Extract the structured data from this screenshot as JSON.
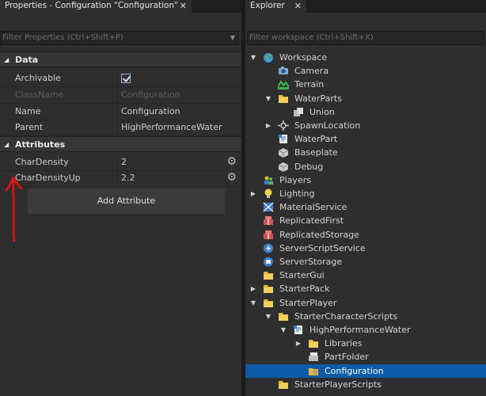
{
  "properties_panel": {
    "tab_title": "Properties - Configuration \"Configuration\"",
    "close_glyph": "✕",
    "filter_placeholder": "Filter Properties (Ctrl+Shift+P)",
    "sections": {
      "data": {
        "title": "Data"
      },
      "attributes": {
        "title": "Attributes"
      }
    },
    "rows": [
      {
        "name": "Archivable",
        "value": "",
        "type": "checkbox",
        "checked": true
      },
      {
        "name": "ClassName",
        "value": "Configuration",
        "type": "readonly"
      },
      {
        "name": "Name",
        "value": "Configuration",
        "type": "text"
      },
      {
        "name": "Parent",
        "value": "HighPerformanceWater",
        "type": "text"
      }
    ],
    "attributes": [
      {
        "name": "CharDensity",
        "value": "2"
      },
      {
        "name": "CharDensityUp",
        "value": "2.2"
      }
    ],
    "add_attribute_label": "Add Attribute",
    "annotation_color": "#d01515"
  },
  "explorer_panel": {
    "tab_title": "Explorer",
    "close_glyph": "✕",
    "filter_placeholder": "Filter workspace (Ctrl+Shift+X)",
    "selection_color": "#0d5aa7",
    "items": [
      {
        "label": "Workspace",
        "icon": "globe-icon",
        "depth": 0,
        "expand": "expanded"
      },
      {
        "label": "Camera",
        "icon": "camera-icon",
        "depth": 1,
        "expand": "none"
      },
      {
        "label": "Terrain",
        "icon": "terrain-icon",
        "depth": 1,
        "expand": "none"
      },
      {
        "label": "WaterParts",
        "icon": "folder-icon",
        "depth": 1,
        "expand": "expanded"
      },
      {
        "label": "Union",
        "icon": "union-icon",
        "depth": 2,
        "expand": "none"
      },
      {
        "label": "SpawnLocation",
        "icon": "spawn-icon",
        "depth": 1,
        "expand": "collapsed"
      },
      {
        "label": "WaterPart",
        "icon": "script-icon",
        "depth": 1,
        "expand": "none"
      },
      {
        "label": "Baseplate",
        "icon": "part-icon",
        "depth": 1,
        "expand": "none"
      },
      {
        "label": "Debug",
        "icon": "part-icon",
        "depth": 1,
        "expand": "none"
      },
      {
        "label": "Players",
        "icon": "players-icon",
        "depth": 0,
        "expand": "none"
      },
      {
        "label": "Lighting",
        "icon": "lightbulb-icon",
        "depth": 0,
        "expand": "collapsed"
      },
      {
        "label": "MaterialService",
        "icon": "material-icon",
        "depth": 0,
        "expand": "none"
      },
      {
        "label": "ReplicatedFirst",
        "icon": "replicated-icon",
        "depth": 0,
        "expand": "none"
      },
      {
        "label": "ReplicatedStorage",
        "icon": "replicated-icon",
        "depth": 0,
        "expand": "none"
      },
      {
        "label": "ServerScriptService",
        "icon": "server-script-icon",
        "depth": 0,
        "expand": "none"
      },
      {
        "label": "ServerStorage",
        "icon": "server-storage-icon",
        "depth": 0,
        "expand": "none"
      },
      {
        "label": "StarterGui",
        "icon": "folder-icon",
        "depth": 0,
        "expand": "none"
      },
      {
        "label": "StarterPack",
        "icon": "folder-icon",
        "depth": 0,
        "expand": "collapsed"
      },
      {
        "label": "StarterPlayer",
        "icon": "folder-icon",
        "depth": 0,
        "expand": "expanded"
      },
      {
        "label": "StarterCharacterScripts",
        "icon": "folder-icon",
        "depth": 1,
        "expand": "expanded"
      },
      {
        "label": "HighPerformanceWater",
        "icon": "script-icon",
        "depth": 2,
        "expand": "expanded"
      },
      {
        "label": "Libraries",
        "icon": "folder-icon",
        "depth": 3,
        "expand": "collapsed"
      },
      {
        "label": "PartFolder",
        "icon": "part-folder-icon",
        "depth": 3,
        "expand": "none"
      },
      {
        "label": "Configuration",
        "icon": "configuration-icon",
        "depth": 3,
        "expand": "none",
        "selected": true
      },
      {
        "label": "StarterPlayerScripts",
        "icon": "folder-icon",
        "depth": 1,
        "expand": "none"
      }
    ]
  }
}
